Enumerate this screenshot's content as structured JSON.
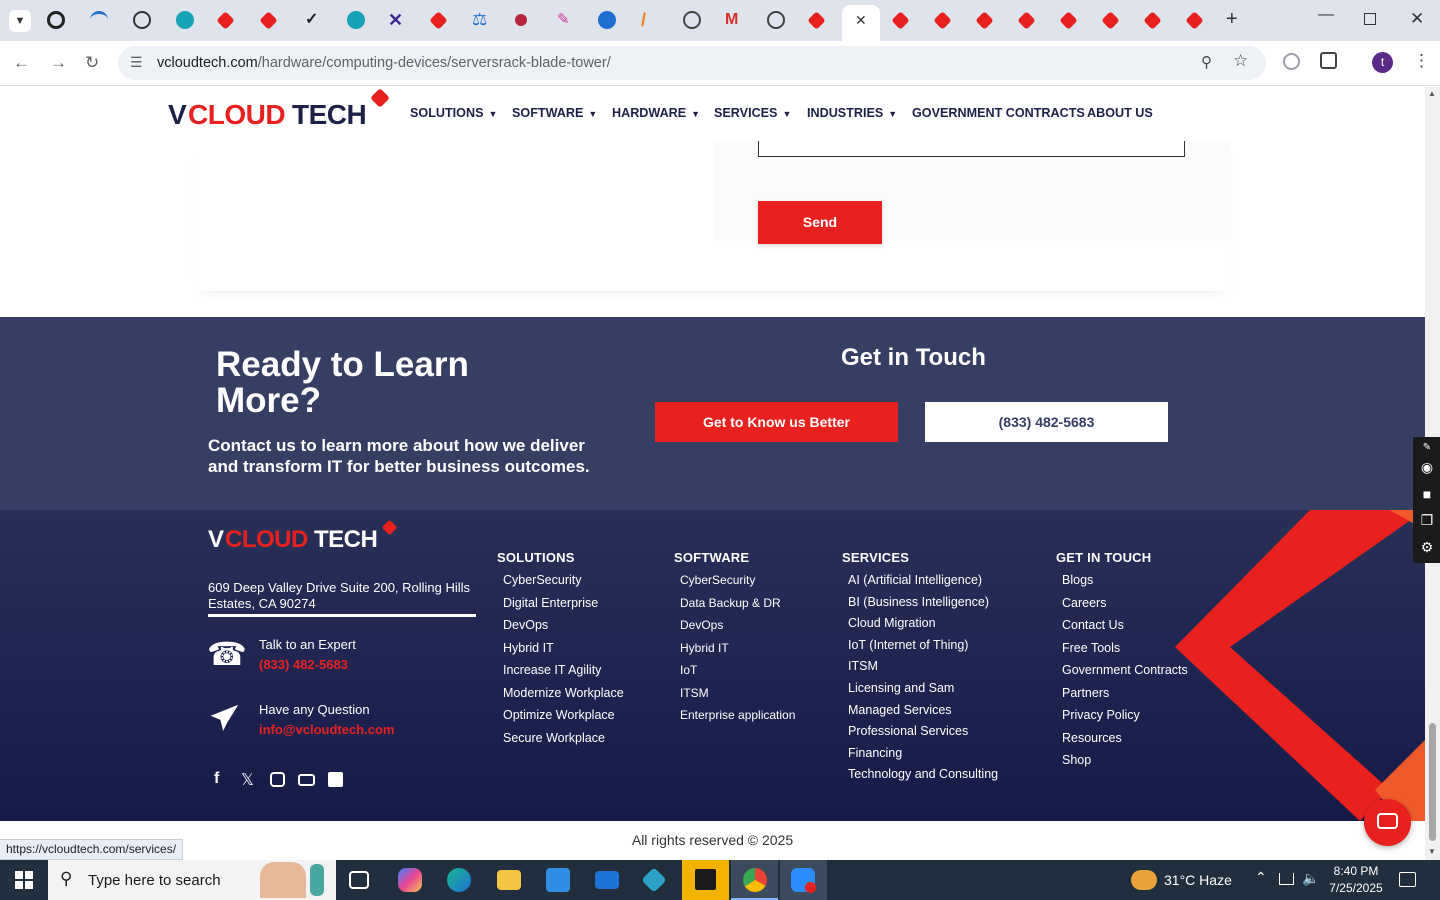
{
  "browser": {
    "url_host": "vcloudtech.com",
    "url_path": "/hardware/computing-devices/serversrack-blade-tower/",
    "status_url": "https://vcloudtech.com/services/"
  },
  "site": {
    "logo_v": "V",
    "logo_cloud": "CLOUD",
    "logo_tech": "TECH",
    "nav": [
      {
        "label": "SOLUTIONS",
        "caret": true
      },
      {
        "label": "SOFTWARE",
        "caret": true
      },
      {
        "label": "HARDWARE",
        "caret": true
      },
      {
        "label": "SERVICES",
        "caret": true
      },
      {
        "label": "INDUSTRIES",
        "caret": true
      },
      {
        "label": "GOVERNMENT CONTRACTS",
        "caret": false
      },
      {
        "label": "ABOUT US",
        "caret": false
      }
    ]
  },
  "form": {
    "send_label": "Send"
  },
  "cta": {
    "title": "Ready to Learn More?",
    "subtitle": "Contact us to learn more about how we deliver and transform IT for better business outcomes.",
    "get_in_touch": "Get in Touch",
    "know_us_button": "Get to Know us Better",
    "phone_button": "(833) 482-5683"
  },
  "footer": {
    "address": "609 Deep Valley Drive Suite 200, Rolling Hills Estates, CA 90274",
    "talk_label": "Talk to an Expert",
    "talk_phone": "(833) 482-5683",
    "question_label": "Have any Question",
    "email": "info@vcloudtech.com",
    "solutions": {
      "heading": "SOLUTIONS",
      "links": [
        "CyberSecurity",
        "Digital Enterprise",
        "DevOps",
        "Hybrid IT",
        "Increase IT Agility",
        "Modernize Workplace",
        "Optimize Workplace",
        "Secure Workplace"
      ]
    },
    "software": {
      "heading": "SOFTWARE",
      "links": [
        "CyberSecurity",
        "Data Backup & DR",
        "DevOps",
        "Hybrid IT",
        "IoT",
        "ITSM",
        "Enterprise application"
      ]
    },
    "services": {
      "heading": "SERVICES",
      "links": [
        "AI (Artificial Intelligence)",
        "BI (Business Intelligence)",
        "Cloud Migration",
        "IoT (Internet of Thing)",
        "ITSM",
        "Licensing and Sam",
        "Managed Services",
        "Professional Services",
        "Financing",
        "Technology and Consulting"
      ]
    },
    "contact": {
      "heading": "GET IN TOUCH",
      "links": [
        "Blogs",
        "Careers",
        "Contact Us",
        "Free Tools",
        "Government Contracts",
        "Partners",
        "Privacy Policy",
        "Resources",
        "Shop"
      ]
    },
    "copyright": "All rights reserved © 2025"
  },
  "taskbar": {
    "search_placeholder": "Type here to search",
    "weather": "31°C  Haze",
    "time": "8:40 PM",
    "date": "7/25/2025"
  },
  "colors": {
    "brand_red": "#e8211f",
    "navy": "#363e63",
    "footer_navy": "#1f2350"
  }
}
